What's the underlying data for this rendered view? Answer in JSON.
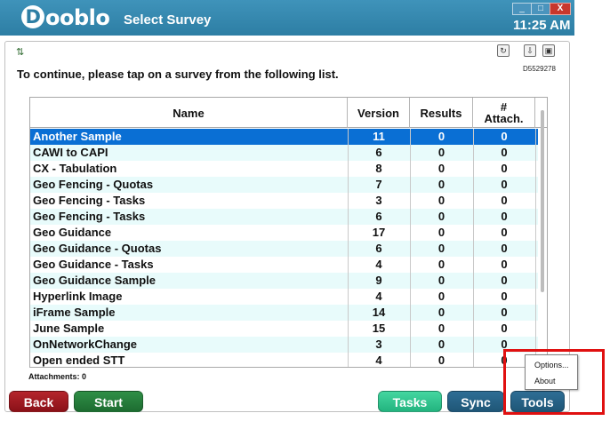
{
  "app": {
    "logo": "Dooblo",
    "window_title": "Select Survey",
    "clock": "11:25 AM"
  },
  "window_controls": {
    "minimize": "_",
    "maximize": "□",
    "close": "X"
  },
  "device_id": "D5529278",
  "instruction": "To continue, please tap on a survey from the following list.",
  "table": {
    "headers": {
      "name": "Name",
      "version": "Version",
      "results": "Results",
      "attach_line1": "#",
      "attach_line2": "Attach."
    },
    "rows": [
      {
        "name": "Another Sample",
        "version": "11",
        "results": "0",
        "attachments": "0",
        "selected": true
      },
      {
        "name": "CAWI to CAPI",
        "version": "6",
        "results": "0",
        "attachments": "0"
      },
      {
        "name": "CX - Tabulation",
        "version": "8",
        "results": "0",
        "attachments": "0"
      },
      {
        "name": "Geo Fencing - Quotas",
        "version": "7",
        "results": "0",
        "attachments": "0"
      },
      {
        "name": "Geo Fencing - Tasks",
        "version": "3",
        "results": "0",
        "attachments": "0"
      },
      {
        "name": "Geo Fencing - Tasks",
        "version": "6",
        "results": "0",
        "attachments": "0"
      },
      {
        "name": "Geo Guidance",
        "version": "17",
        "results": "0",
        "attachments": "0"
      },
      {
        "name": "Geo Guidance - Quotas",
        "version": "6",
        "results": "0",
        "attachments": "0"
      },
      {
        "name": "Geo Guidance - Tasks",
        "version": "4",
        "results": "0",
        "attachments": "0"
      },
      {
        "name": "Geo Guidance Sample",
        "version": "9",
        "results": "0",
        "attachments": "0"
      },
      {
        "name": "Hyperlink Image",
        "version": "4",
        "results": "0",
        "attachments": "0"
      },
      {
        "name": "iFrame Sample",
        "version": "14",
        "results": "0",
        "attachments": "0"
      },
      {
        "name": "June Sample",
        "version": "15",
        "results": "0",
        "attachments": "0"
      },
      {
        "name": "OnNetworkChange",
        "version": "3",
        "results": "0",
        "attachments": "0"
      },
      {
        "name": "Open ended STT",
        "version": "4",
        "results": "0",
        "attachments": "0"
      }
    ]
  },
  "attachments_label": "Attachments: 0",
  "buttons": {
    "back": "Back",
    "start": "Start",
    "tasks": "Tasks",
    "sync": "Sync",
    "tools": "Tools"
  },
  "tools_menu": {
    "options": "Options...",
    "about": "About"
  },
  "colors": {
    "title_bar": "#2d7ea4",
    "selection": "#0a6fd4",
    "alt_row": "#e8fbfb",
    "highlight_box": "#e01010"
  }
}
